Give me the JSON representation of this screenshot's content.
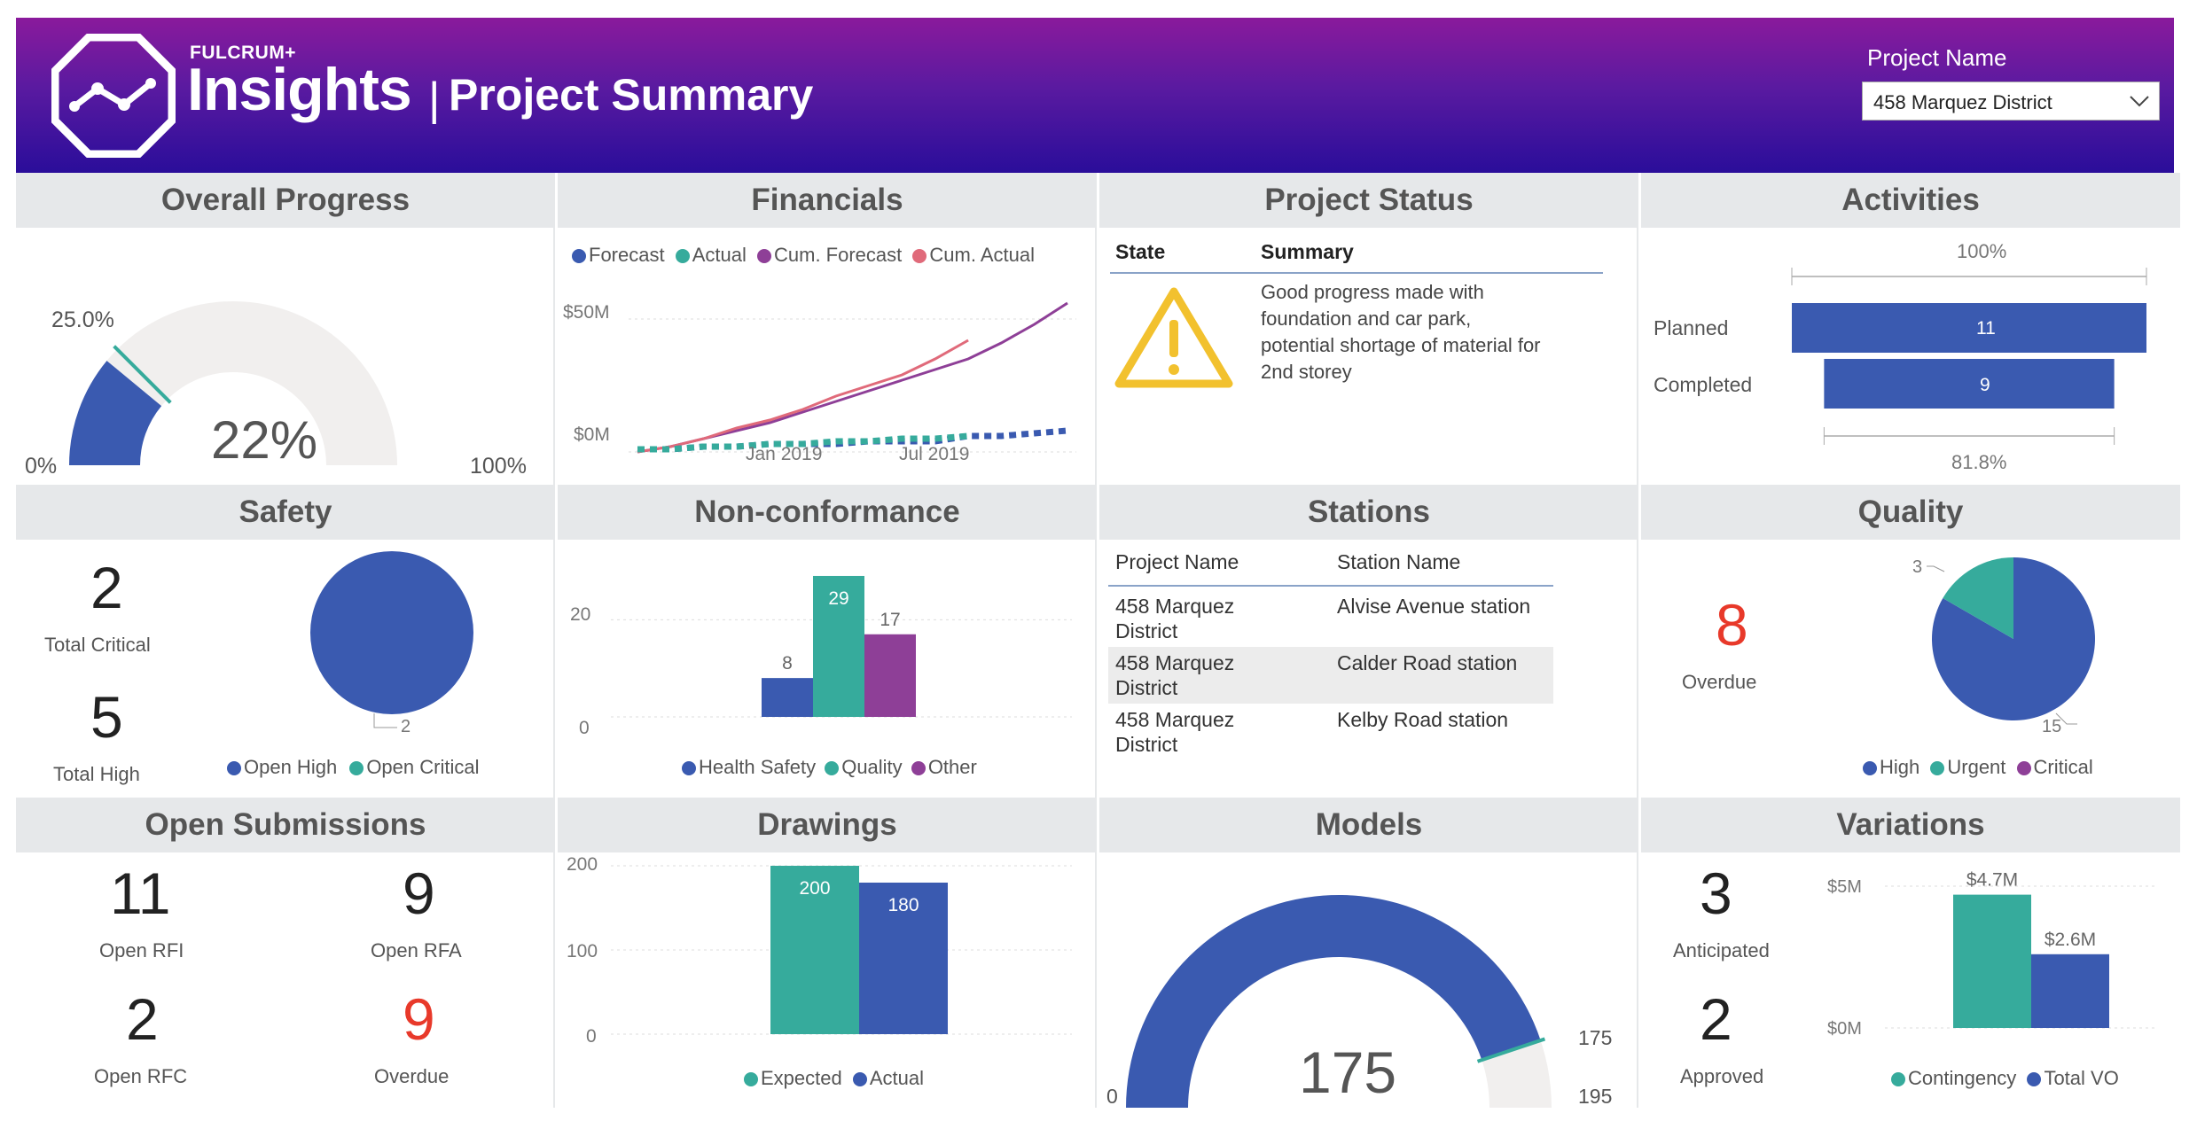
{
  "header": {
    "brand_small": "FULCRUM+",
    "brand_big": "Insights",
    "separator": "|",
    "title": "Project Summary",
    "project_label": "Project Name",
    "project_value": "458 Marquez District",
    "icon": "line-chart-octagon-icon"
  },
  "colors": {
    "blue": "#3a5ab0",
    "teal": "#36ab9c",
    "purple": "#8e3f97",
    "pink": "#e06a7a",
    "red": "#e8392a",
    "gauge_bg": "#f1efee"
  },
  "overall_progress": {
    "title": "Overall Progress",
    "value_label": "22%",
    "value": 22,
    "target_label": "25.0%",
    "target": 25,
    "min_label": "0%",
    "max_label": "100%"
  },
  "financials": {
    "title": "Financials",
    "legend": [
      "Forecast",
      "Actual",
      "Cum. Forecast",
      "Cum. Actual"
    ],
    "y_ticks": [
      "$50M",
      "$0M"
    ],
    "x_ticks": [
      "Jan 2019",
      "Jul 2019"
    ]
  },
  "project_status": {
    "title": "Project Status",
    "col_state": "State",
    "col_summary": "Summary",
    "summary_lines": [
      "Good progress made with",
      "foundation and car park,",
      "potential shortage of material for",
      "2nd storey"
    ],
    "icon": "warning-triangle-icon"
  },
  "activities": {
    "title": "Activities",
    "top_label": "100%",
    "bottom_label": "81.8%",
    "planned_label": "Planned",
    "planned_value": "11",
    "planned": 11,
    "completed_label": "Completed",
    "completed_value": "9",
    "completed": 9
  },
  "safety": {
    "title": "Safety",
    "critical_value": "2",
    "critical_label": "Total Critical",
    "high_value": "5",
    "high_label": "Total High",
    "pie_label": "2",
    "legend": [
      "Open High",
      "Open Critical"
    ]
  },
  "nonconformance": {
    "title": "Non-conformance",
    "y_ticks": [
      "20",
      "0"
    ],
    "legend": [
      "Health Safety",
      "Quality",
      "Other"
    ],
    "labels": [
      "8",
      "29",
      "17"
    ]
  },
  "stations": {
    "title": "Stations",
    "col1": "Project Name",
    "col2": "Station Name",
    "rows": [
      {
        "p1": "458 Marquez",
        "p2": "District",
        "s": "Alvise Avenue station"
      },
      {
        "p1": "458 Marquez",
        "p2": "District",
        "s": "Calder Road station"
      },
      {
        "p1": "458 Marquez",
        "p2": "District",
        "s": "Kelby Road station"
      }
    ]
  },
  "quality": {
    "title": "Quality",
    "overdue_value": "8",
    "overdue_label": "Overdue",
    "pie_small_label": "3",
    "pie_big_label": "15",
    "legend": [
      "High",
      "Urgent",
      "Critical"
    ]
  },
  "open_submissions": {
    "title": "Open Submissions",
    "rfi_value": "11",
    "rfi_label": "Open RFI",
    "rfa_value": "9",
    "rfa_label": "Open RFA",
    "rfc_value": "2",
    "rfc_label": "Open RFC",
    "overdue_value": "9",
    "overdue_label": "Overdue"
  },
  "drawings": {
    "title": "Drawings",
    "y_ticks": [
      "200",
      "100",
      "0"
    ],
    "labels": [
      "200",
      "180"
    ],
    "legend": [
      "Expected",
      "Actual"
    ]
  },
  "models": {
    "title": "Models",
    "value_label": "175",
    "value": 175,
    "target_label": "175",
    "min_label": "0",
    "max_label": "195",
    "max": 195
  },
  "variations": {
    "title": "Variations",
    "anticipated_value": "3",
    "anticipated_label": "Anticipated",
    "approved_value": "2",
    "approved_label": "Approved",
    "y_ticks": [
      "$5M",
      "$0M"
    ],
    "labels": [
      "$4.7M",
      "$2.6M"
    ],
    "legend": [
      "Contingency",
      "Total VO"
    ]
  },
  "chart_data": [
    {
      "type": "gauge",
      "title": "Overall Progress",
      "value": 22,
      "target": 25,
      "min": 0,
      "max": 100
    },
    {
      "type": "line",
      "title": "Financials",
      "x": [
        "2018-10",
        "2018-11",
        "2018-12",
        "2019-01",
        "2019-02",
        "2019-03",
        "2019-04",
        "2019-05",
        "2019-06",
        "2019-07",
        "2019-08",
        "2019-09",
        "2019-10",
        "2019-11"
      ],
      "series": [
        {
          "name": "Cum. Forecast",
          "values": [
            0,
            2,
            5,
            8,
            11,
            15,
            19,
            23,
            27,
            31,
            35,
            41,
            48,
            56
          ]
        },
        {
          "name": "Cum. Actual",
          "values": [
            0,
            2,
            5,
            9,
            12,
            16,
            21,
            25,
            29,
            35,
            42,
            null,
            null,
            null
          ]
        },
        {
          "name": "Forecast",
          "values": [
            1,
            1,
            2,
            2,
            3,
            3,
            3,
            4,
            4,
            4,
            6,
            6,
            7,
            8
          ]
        },
        {
          "name": "Actual",
          "values": [
            1,
            1,
            2,
            2,
            3,
            3,
            4,
            4,
            5,
            5,
            6,
            null,
            null,
            null
          ]
        }
      ],
      "ylim": [
        0,
        60
      ]
    },
    {
      "type": "bar",
      "title": "Activities",
      "categories": [
        "Planned",
        "Completed"
      ],
      "values": [
        11,
        9
      ]
    },
    {
      "type": "pie",
      "title": "Safety",
      "categories": [
        "Open High",
        "Open Critical"
      ],
      "values": [
        2,
        0
      ]
    },
    {
      "type": "bar",
      "title": "Non-conformance",
      "categories": [
        "Health Safety",
        "Quality",
        "Other"
      ],
      "values": [
        8,
        29,
        17
      ],
      "ylim": [
        0,
        30
      ]
    },
    {
      "type": "pie",
      "title": "Quality",
      "categories": [
        "High",
        "Urgent",
        "Critical"
      ],
      "values": [
        15,
        3,
        0
      ]
    },
    {
      "type": "bar",
      "title": "Drawings",
      "categories": [
        "Expected",
        "Actual"
      ],
      "values": [
        200,
        180
      ],
      "ylim": [
        0,
        200
      ]
    },
    {
      "type": "gauge",
      "title": "Models",
      "value": 175,
      "target": 175,
      "min": 0,
      "max": 195
    },
    {
      "type": "bar",
      "title": "Variations",
      "categories": [
        "Contingency",
        "Total VO"
      ],
      "values": [
        4.7,
        2.6
      ],
      "ylabel": "",
      "ylim": [
        0,
        5
      ]
    }
  ]
}
